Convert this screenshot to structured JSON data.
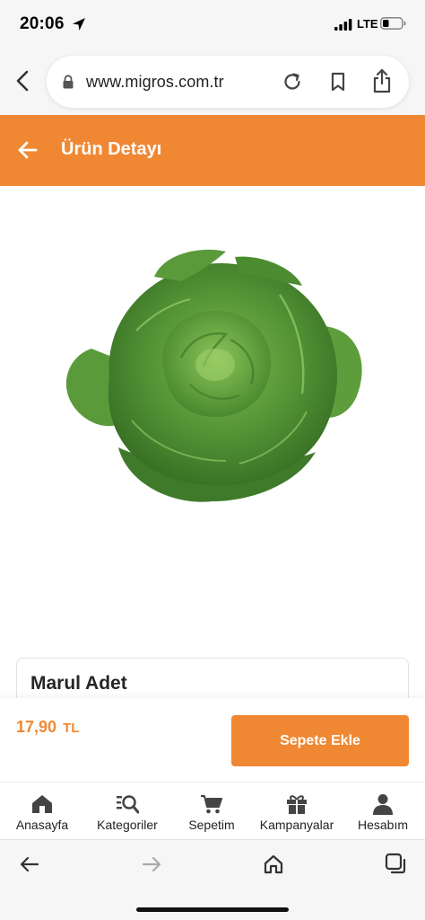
{
  "status_bar": {
    "time": "20:06",
    "network": "LTE",
    "icons": [
      "location-arrow-icon",
      "signal-icon",
      "battery-icon"
    ]
  },
  "browser": {
    "url": "www.migros.com.tr",
    "icons": [
      "back-icon",
      "lock-icon",
      "reload-icon",
      "bookmark-icon",
      "share-icon"
    ]
  },
  "header": {
    "title": "Ürün Detayı",
    "background": "#f08833"
  },
  "product": {
    "name": "Marul Adet",
    "price": "17,90",
    "currency": "TL",
    "add_to_cart_label": "Sepete Ekle",
    "image": "lettuce"
  },
  "bottom_nav": {
    "items": [
      {
        "label": "Anasayfa",
        "icon": "home-icon"
      },
      {
        "label": "Kategoriler",
        "icon": "category-search-icon"
      },
      {
        "label": "Sepetim",
        "icon": "cart-icon"
      },
      {
        "label": "Kampanyalar",
        "icon": "gift-icon"
      },
      {
        "label": "Hesabım",
        "icon": "user-icon"
      }
    ]
  },
  "safari_toolbar": {
    "icons": [
      "back-arrow-icon",
      "forward-arrow-icon",
      "home-icon",
      "tabs-icon"
    ]
  },
  "colors": {
    "accent": "#f08833",
    "lettuce_dark": "#3f7a2a",
    "lettuce_light": "#6faa45"
  }
}
